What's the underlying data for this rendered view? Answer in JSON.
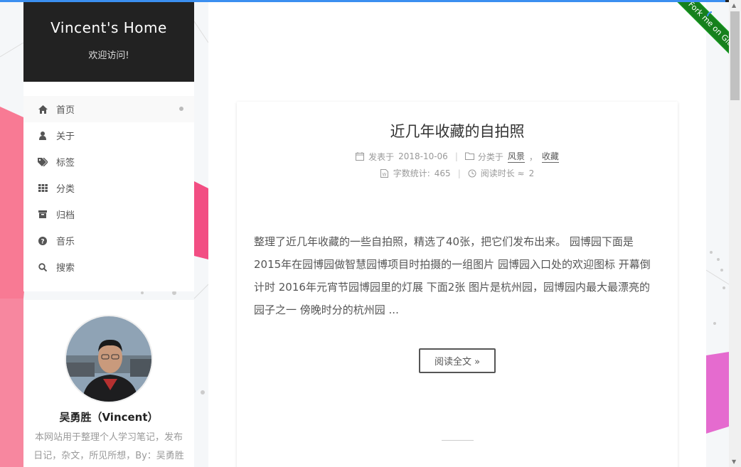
{
  "site": {
    "title": "Vincent's Home",
    "subtitle": "欢迎访问!"
  },
  "menu": {
    "items": [
      {
        "label": "首页",
        "icon": "home-icon",
        "active": true
      },
      {
        "label": "关于",
        "icon": "user-icon"
      },
      {
        "label": "标签",
        "icon": "tags-icon"
      },
      {
        "label": "分类",
        "icon": "th-icon"
      },
      {
        "label": "归档",
        "icon": "archive-icon"
      },
      {
        "label": "音乐",
        "icon": "question-circle-icon"
      },
      {
        "label": "搜索",
        "icon": "search-icon"
      }
    ]
  },
  "profile": {
    "name": "吴勇胜（Vincent）",
    "description": "本网站用于整理个人学习笔记，发布日记，杂文，所见所想，By：吴勇胜"
  },
  "post": {
    "title": "近几年收藏的自拍照",
    "published_label": "发表于",
    "published_date": "2018-10-06",
    "category_label": "分类于",
    "categories": [
      "风景",
      "收藏"
    ],
    "category_separator": "，",
    "wordcount_label": "字数统计:",
    "wordcount": "465",
    "readtime_label": "阅读时长 ≈",
    "readtime": "2",
    "excerpt": "整理了近几年收藏的一些自拍照，精选了40张，把它们发布出来。 园博园下面是2015年在园博园做智慧园博项目时拍摄的一组图片 园博园入口处的欢迎图标 开幕倒计时 2016年元宵节园博园里的灯展 下面2张 图片是杭州园，园博园内最大最漂亮的园子之一 傍晚时分的杭州园 ...",
    "read_more": "阅读全文 »"
  },
  "ribbon": {
    "label": "Fork me on GitHub",
    "color": "#16801d"
  },
  "colors": {
    "accent": "#3b8ff0",
    "brand_bg": "#222222"
  }
}
